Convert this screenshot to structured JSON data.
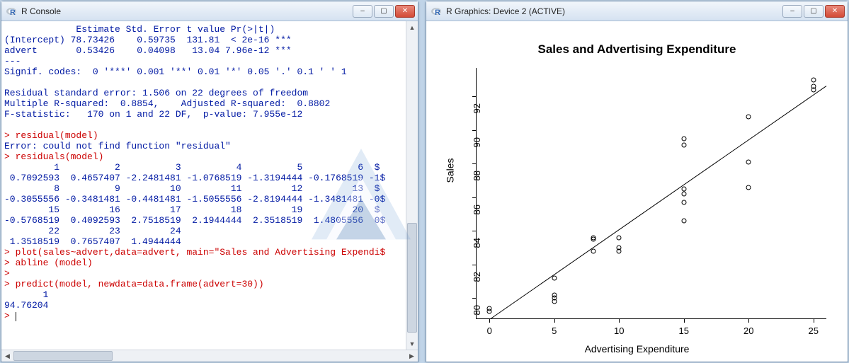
{
  "console": {
    "title": "R Console",
    "lines": [
      {
        "cls": "blue",
        "text": "             Estimate Std. Error t value Pr(>|t|)    "
      },
      {
        "cls": "blue",
        "text": "(Intercept) 78.73426    0.59735  131.81  < 2e-16 ***"
      },
      {
        "cls": "blue",
        "text": "advert       0.53426    0.04098   13.04 7.96e-12 ***"
      },
      {
        "cls": "blue",
        "text": "---"
      },
      {
        "cls": "blue",
        "text": "Signif. codes:  0 '***' 0.001 '**' 0.01 '*' 0.05 '.' 0.1 ' ' 1"
      },
      {
        "cls": "blue",
        "text": ""
      },
      {
        "cls": "blue",
        "text": "Residual standard error: 1.506 on 22 degrees of freedom"
      },
      {
        "cls": "blue",
        "text": "Multiple R-squared:  0.8854,    Adjusted R-squared:  0.8802 "
      },
      {
        "cls": "blue",
        "text": "F-statistic:   170 on 1 and 22 DF,  p-value: 7.955e-12"
      },
      {
        "cls": "blue",
        "text": ""
      },
      {
        "cls": "red",
        "text": "> residual(model)"
      },
      {
        "cls": "blue",
        "text": "Error: could not find function \"residual\""
      },
      {
        "cls": "red",
        "text": "> residuals(model)"
      },
      {
        "cls": "blue",
        "text": "         1          2          3          4          5          6  $"
      },
      {
        "cls": "blue",
        "text": " 0.7092593  0.4657407 -2.2481481 -1.0768519 -1.3194444 -0.1768519 -1$"
      },
      {
        "cls": "blue",
        "text": "         8          9         10         11         12         13  $"
      },
      {
        "cls": "blue",
        "text": "-0.3055556 -0.3481481 -0.4481481 -1.5055556 -2.8194444 -1.3481481 -0$"
      },
      {
        "cls": "blue",
        "text": "        15         16         17         18         19         20  $"
      },
      {
        "cls": "blue",
        "text": "-0.5768519  0.4092593  2.7518519  2.1944444  2.3518519  1.4805556  0$"
      },
      {
        "cls": "blue",
        "text": "        22         23         24 "
      },
      {
        "cls": "blue",
        "text": " 1.3518519  0.7657407  1.4944444 "
      },
      {
        "cls": "red",
        "text": "> plot(sales~advert,data=advert, main=\"Sales and Advertising Expendi$"
      },
      {
        "cls": "red",
        "text": "> abline (model)"
      },
      {
        "cls": "red",
        "text": "> "
      },
      {
        "cls": "red",
        "text": "> predict(model, newdata=data.frame(advert=30))"
      },
      {
        "cls": "blue",
        "text": "       1 "
      },
      {
        "cls": "blue",
        "text": "94.76204 "
      },
      {
        "cls": "red",
        "text": "> ",
        "cursor": true
      }
    ]
  },
  "graphics": {
    "title": "R Graphics: Device 2 (ACTIVE)"
  },
  "window_controls": {
    "min": "–",
    "max": "▢",
    "close": "✕"
  },
  "chart_data": {
    "type": "scatter",
    "title": "Sales and Advertising Expenditure",
    "xlabel": "Advertising Expenditure",
    "ylabel": "Sales",
    "xticks": [
      0,
      5,
      10,
      15,
      20,
      25
    ],
    "yticks": [
      80,
      82,
      84,
      86,
      88,
      90,
      92
    ],
    "xlim": [
      -1.0,
      26.0
    ],
    "ylim": [
      78.8,
      93.7
    ],
    "abline": {
      "intercept": 78.73426,
      "slope": 0.53426
    },
    "points": [
      {
        "x": 0,
        "y": 79.4
      },
      {
        "x": 0,
        "y": 79.2
      },
      {
        "x": 5,
        "y": 81.2
      },
      {
        "x": 5,
        "y": 80.2
      },
      {
        "x": 5,
        "y": 80.0
      },
      {
        "x": 5,
        "y": 79.8
      },
      {
        "x": 8,
        "y": 82.8
      },
      {
        "x": 8,
        "y": 83.5
      },
      {
        "x": 8,
        "y": 83.6
      },
      {
        "x": 10,
        "y": 83.0
      },
      {
        "x": 10,
        "y": 82.8
      },
      {
        "x": 10,
        "y": 83.6
      },
      {
        "x": 15,
        "y": 84.6
      },
      {
        "x": 15,
        "y": 85.7
      },
      {
        "x": 15,
        "y": 86.2
      },
      {
        "x": 15,
        "y": 86.5
      },
      {
        "x": 15,
        "y": 89.1
      },
      {
        "x": 15,
        "y": 89.5
      },
      {
        "x": 20,
        "y": 86.6
      },
      {
        "x": 20,
        "y": 88.1
      },
      {
        "x": 20,
        "y": 90.8
      },
      {
        "x": 25,
        "y": 92.4
      },
      {
        "x": 25,
        "y": 92.6
      },
      {
        "x": 25,
        "y": 93.0
      }
    ]
  }
}
